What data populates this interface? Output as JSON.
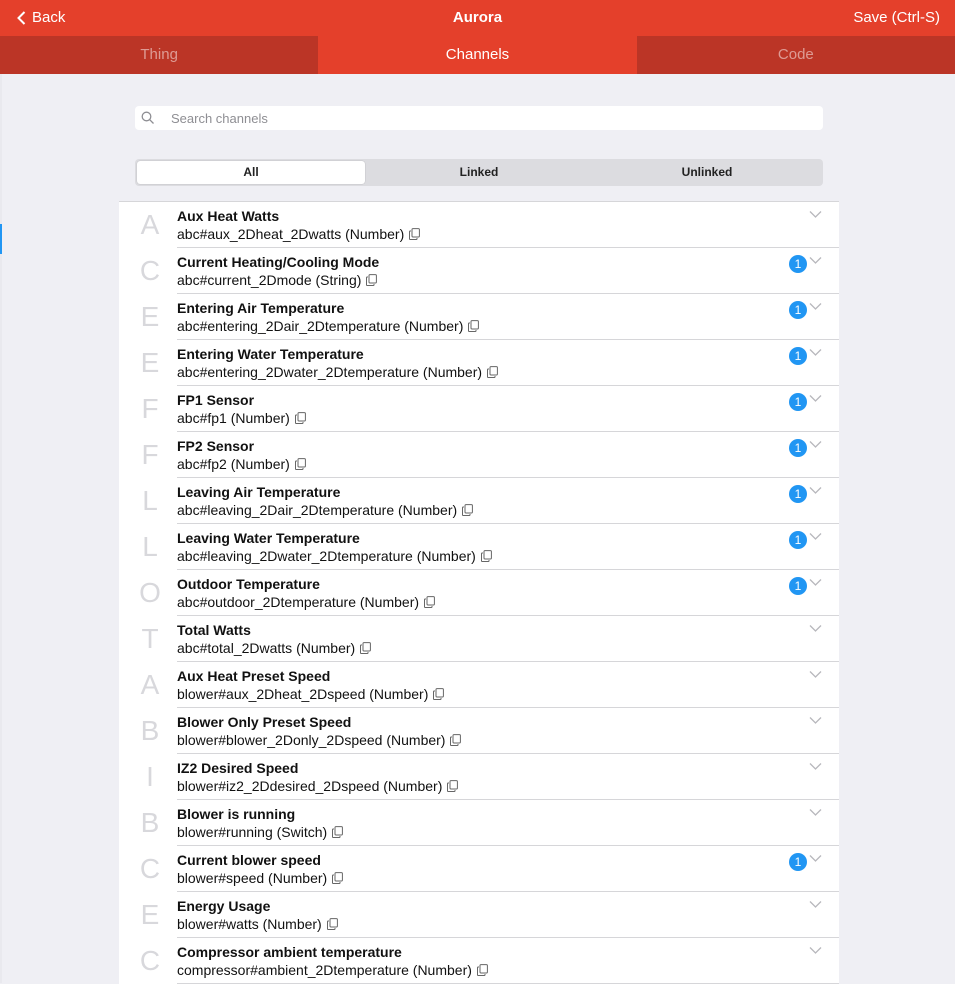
{
  "nav": {
    "back_label": "Back",
    "title": "Aurora",
    "save_label": "Save (Ctrl-S)"
  },
  "tabs": [
    {
      "label": "Thing",
      "active": false
    },
    {
      "label": "Channels",
      "active": true
    },
    {
      "label": "Code",
      "active": false
    }
  ],
  "search": {
    "placeholder": "Search channels",
    "value": ""
  },
  "filter": {
    "options": [
      "All",
      "Linked",
      "Unlinked"
    ],
    "selected": "All"
  },
  "colors": {
    "accent": "#e4402b",
    "badge": "#2196f3"
  },
  "channels": [
    {
      "letter": "A",
      "title": "Aux Heat Watts",
      "subtitle": "abc#aux_2Dheat_2Dwatts (Number)",
      "badge": ""
    },
    {
      "letter": "C",
      "title": "Current Heating/Cooling Mode",
      "subtitle": "abc#current_2Dmode (String)",
      "badge": "1"
    },
    {
      "letter": "E",
      "title": "Entering Air Temperature",
      "subtitle": "abc#entering_2Dair_2Dtemperature (Number)",
      "badge": "1"
    },
    {
      "letter": "E",
      "title": "Entering Water Temperature",
      "subtitle": "abc#entering_2Dwater_2Dtemperature (Number)",
      "badge": "1"
    },
    {
      "letter": "F",
      "title": "FP1 Sensor",
      "subtitle": "abc#fp1 (Number)",
      "badge": "1"
    },
    {
      "letter": "F",
      "title": "FP2 Sensor",
      "subtitle": "abc#fp2 (Number)",
      "badge": "1"
    },
    {
      "letter": "L",
      "title": "Leaving Air Temperature",
      "subtitle": "abc#leaving_2Dair_2Dtemperature (Number)",
      "badge": "1"
    },
    {
      "letter": "L",
      "title": "Leaving Water Temperature",
      "subtitle": "abc#leaving_2Dwater_2Dtemperature (Number)",
      "badge": "1"
    },
    {
      "letter": "O",
      "title": "Outdoor Temperature",
      "subtitle": "abc#outdoor_2Dtemperature (Number)",
      "badge": "1"
    },
    {
      "letter": "T",
      "title": "Total Watts",
      "subtitle": "abc#total_2Dwatts (Number)",
      "badge": ""
    },
    {
      "letter": "A",
      "title": "Aux Heat Preset Speed",
      "subtitle": "blower#aux_2Dheat_2Dspeed (Number)",
      "badge": ""
    },
    {
      "letter": "B",
      "title": "Blower Only Preset Speed",
      "subtitle": "blower#blower_2Donly_2Dspeed (Number)",
      "badge": ""
    },
    {
      "letter": "I",
      "title": "IZ2 Desired Speed",
      "subtitle": "blower#iz2_2Ddesired_2Dspeed (Number)",
      "badge": ""
    },
    {
      "letter": "B",
      "title": "Blower is running",
      "subtitle": "blower#running (Switch)",
      "badge": ""
    },
    {
      "letter": "C",
      "title": "Current blower speed",
      "subtitle": "blower#speed (Number)",
      "badge": "1"
    },
    {
      "letter": "E",
      "title": "Energy Usage",
      "subtitle": "blower#watts (Number)",
      "badge": ""
    },
    {
      "letter": "C",
      "title": "Compressor ambient temperature",
      "subtitle": "compressor#ambient_2Dtemperature (Number)",
      "badge": ""
    }
  ]
}
